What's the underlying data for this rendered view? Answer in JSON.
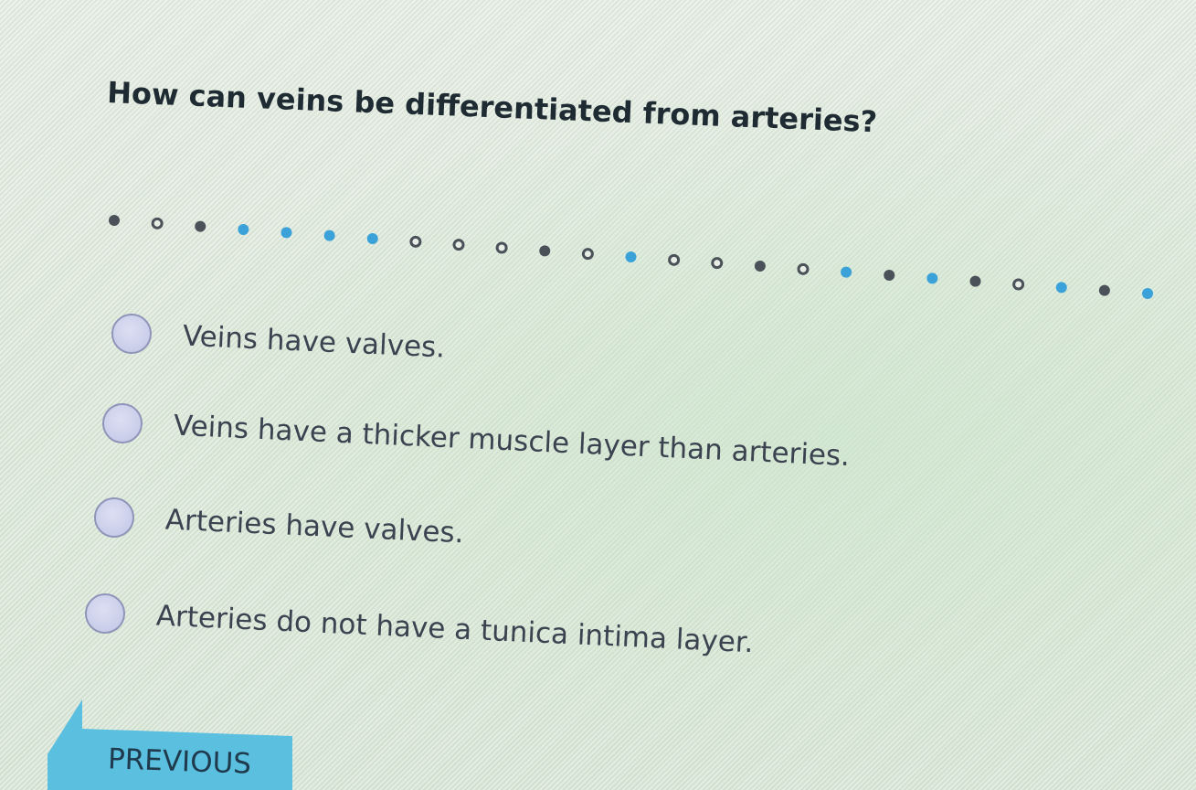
{
  "question": {
    "text": "How can veins be differentiated from arteries?"
  },
  "progress_dots": {
    "icon": "progress-dot-icon",
    "colors": {
      "filled_dark": "#4a5158",
      "open_dark": "#4a5158",
      "filled_blue": "#3aa2d8"
    },
    "states": [
      "filled_dark",
      "open_dark",
      "filled_dark",
      "filled_blue",
      "filled_blue",
      "filled_blue",
      "filled_blue",
      "open_dark",
      "open_dark",
      "open_dark",
      "filled_dark",
      "open_dark",
      "filled_blue",
      "open_dark",
      "open_dark",
      "filled_dark",
      "open_dark",
      "filled_blue",
      "filled_dark",
      "filled_blue",
      "filled_dark",
      "open_dark",
      "filled_blue",
      "filled_dark",
      "filled_blue"
    ]
  },
  "options": [
    {
      "label": "Veins have valves."
    },
    {
      "label": "Veins have a thicker muscle layer than arteries."
    },
    {
      "label": "Arteries have valves."
    },
    {
      "label": "Arteries do not have a tunica intima layer."
    }
  ],
  "navigation": {
    "previous_label": "PREVIOUS",
    "button_color": "#5bbfe0",
    "icon": "arrow-left-icon"
  }
}
